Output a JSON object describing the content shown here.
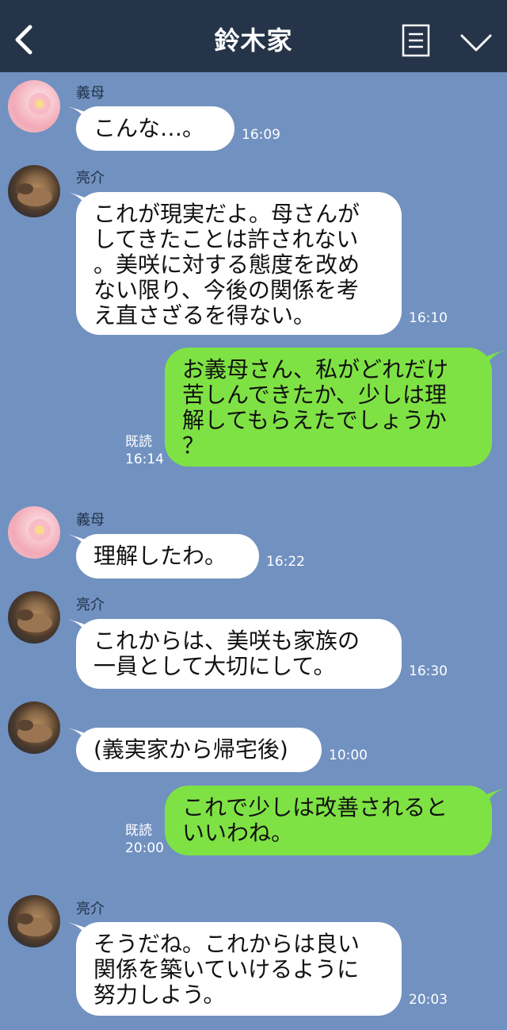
{
  "header": {
    "title": "鈴木家",
    "back_icon": "chevron-left-icon",
    "menu_icon": "list-icon",
    "more_icon": "chevron-down-icon",
    "bg_color": "#263449"
  },
  "colors": {
    "background": "#7191c0",
    "incoming_bubble": "#ffffff",
    "outgoing_bubble": "#7fe244"
  },
  "messages": [
    {
      "sender": "義母",
      "text": "こんな…。",
      "time": "16:09"
    },
    {
      "sender": "亮介",
      "text": "これが現実だよ。母さんが\nしてきたことは許されない\n。美咲に対する態度を改め\nない限り、今後の関係を考\nえ直さざるを得ない。",
      "time": "16:10"
    },
    {
      "sender": "me",
      "text": "お義母さん、私がどれだけ\n苦しんできたか、少しは理\n解してもらえたでしょうか\n？",
      "read": "既読",
      "time": "16:14"
    },
    {
      "sender": "義母",
      "text": "理解したわ。",
      "time": "16:22"
    },
    {
      "sender": "亮介",
      "text": "これからは、美咲も家族の\n一員として大切にして。",
      "time": "16:30"
    },
    {
      "sender": "亮介",
      "text": "(義実家から帰宅後)",
      "time": "10:00"
    },
    {
      "sender": "me",
      "text": "これで少しは改善されると\nいいわね。",
      "read": "既読",
      "time": "20:00"
    },
    {
      "sender": "亮介",
      "text": "そうだね。これからは良い\n関係を築いていけるように\n努力しよう。",
      "time": "20:03"
    }
  ]
}
